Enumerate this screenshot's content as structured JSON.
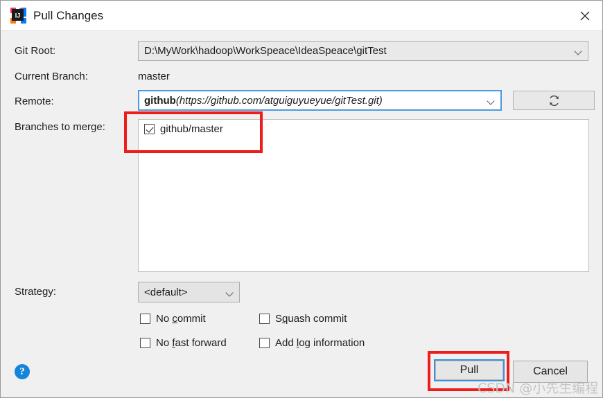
{
  "window": {
    "title": "Pull Changes",
    "app_icon": "intellij-idea-icon",
    "close_icon": "close-icon"
  },
  "form": {
    "git_root": {
      "label": "Git Root:",
      "value": "D:\\MyWork\\hadoop\\WorkSpeace\\IdeaSpeace\\gitTest"
    },
    "current_branch": {
      "label": "Current Branch:",
      "value": "master"
    },
    "remote": {
      "label": "Remote:",
      "name": "github",
      "url": "(https://github.com/atguiguyueyue/gitTest.git)",
      "refresh_icon": "refresh-icon"
    },
    "branches": {
      "label": "Branches to merge:",
      "items": [
        {
          "name": "github/master",
          "checked": true
        }
      ]
    },
    "strategy": {
      "label": "Strategy:",
      "value": "<default>"
    },
    "options": [
      {
        "pre": "No ",
        "mnemonic": "c",
        "post": "ommit",
        "checked": false
      },
      {
        "pre": "S",
        "mnemonic": "q",
        "post": "uash commit",
        "checked": false
      },
      {
        "pre": "No ",
        "mnemonic": "f",
        "post": "ast forward",
        "checked": false
      },
      {
        "pre": "Add ",
        "mnemonic": "l",
        "post": "og information",
        "checked": false
      }
    ]
  },
  "footer": {
    "help_label": "?",
    "pull_label": "Pull",
    "cancel_label": "Cancel"
  },
  "watermark": "CSDN @小先生编程",
  "colors": {
    "focus_blue": "#3f8fdb",
    "annotation_red": "#ef1c1c",
    "help_blue": "#1684d8",
    "dialog_bg": "#f0f0f0"
  }
}
